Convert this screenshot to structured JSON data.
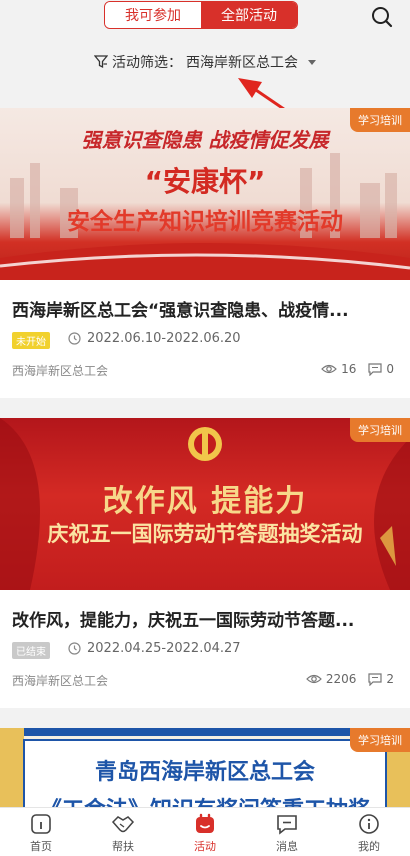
{
  "tabs": {
    "my": "我可参加",
    "all": "全部活动"
  },
  "filter": {
    "label": "活动筛选：",
    "value": "西海岸新区总工会"
  },
  "cards": [
    {
      "tag": "学习培训",
      "banner_line1": "强意识查隐患 战疫情促发展",
      "banner_line2": "“安康杯”",
      "banner_line3": "安全生产知识培训竞赛活动",
      "title": "西海岸新区总工会“强意识查隐患、战疫情...",
      "status": "未开始",
      "date": "2022.06.10-2022.06.20",
      "org": "西海岸新区总工会",
      "views": "16",
      "comments": "0"
    },
    {
      "tag": "学习培训",
      "banner_line1": "改作风  提能力",
      "banner_line2": "庆祝五一国际劳动节答题抽奖活动",
      "title": "改作风，提能力，庆祝五一国际劳动节答题...",
      "status": "已结束",
      "date": "2022.04.25-2022.04.27",
      "org": "西海岸新区总工会",
      "views": "2206",
      "comments": "2"
    },
    {
      "tag": "学习培训",
      "banner_line1": "青岛西海岸新区总工会",
      "banner_line2": "《工会法》知识有奖问答重工抽奖"
    }
  ],
  "nav": [
    "首页",
    "帮扶",
    "活动",
    "消息",
    "我的"
  ]
}
